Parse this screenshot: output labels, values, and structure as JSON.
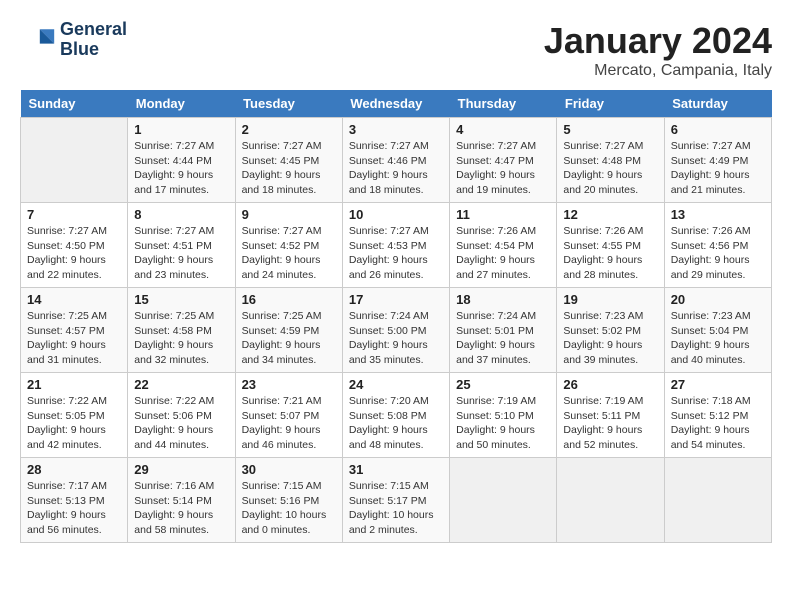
{
  "header": {
    "logo_line1": "General",
    "logo_line2": "Blue",
    "month": "January 2024",
    "location": "Mercato, Campania, Italy"
  },
  "days_of_week": [
    "Sunday",
    "Monday",
    "Tuesday",
    "Wednesday",
    "Thursday",
    "Friday",
    "Saturday"
  ],
  "weeks": [
    [
      {
        "day": "",
        "empty": true
      },
      {
        "day": "1",
        "sunrise": "7:27 AM",
        "sunset": "4:44 PM",
        "daylight": "9 hours and 17 minutes."
      },
      {
        "day": "2",
        "sunrise": "7:27 AM",
        "sunset": "4:45 PM",
        "daylight": "9 hours and 18 minutes."
      },
      {
        "day": "3",
        "sunrise": "7:27 AM",
        "sunset": "4:46 PM",
        "daylight": "9 hours and 18 minutes."
      },
      {
        "day": "4",
        "sunrise": "7:27 AM",
        "sunset": "4:47 PM",
        "daylight": "9 hours and 19 minutes."
      },
      {
        "day": "5",
        "sunrise": "7:27 AM",
        "sunset": "4:48 PM",
        "daylight": "9 hours and 20 minutes."
      },
      {
        "day": "6",
        "sunrise": "7:27 AM",
        "sunset": "4:49 PM",
        "daylight": "9 hours and 21 minutes."
      }
    ],
    [
      {
        "day": "7",
        "sunrise": "7:27 AM",
        "sunset": "4:50 PM",
        "daylight": "9 hours and 22 minutes."
      },
      {
        "day": "8",
        "sunrise": "7:27 AM",
        "sunset": "4:51 PM",
        "daylight": "9 hours and 23 minutes."
      },
      {
        "day": "9",
        "sunrise": "7:27 AM",
        "sunset": "4:52 PM",
        "daylight": "9 hours and 24 minutes."
      },
      {
        "day": "10",
        "sunrise": "7:27 AM",
        "sunset": "4:53 PM",
        "daylight": "9 hours and 26 minutes."
      },
      {
        "day": "11",
        "sunrise": "7:26 AM",
        "sunset": "4:54 PM",
        "daylight": "9 hours and 27 minutes."
      },
      {
        "day": "12",
        "sunrise": "7:26 AM",
        "sunset": "4:55 PM",
        "daylight": "9 hours and 28 minutes."
      },
      {
        "day": "13",
        "sunrise": "7:26 AM",
        "sunset": "4:56 PM",
        "daylight": "9 hours and 29 minutes."
      }
    ],
    [
      {
        "day": "14",
        "sunrise": "7:25 AM",
        "sunset": "4:57 PM",
        "daylight": "9 hours and 31 minutes."
      },
      {
        "day": "15",
        "sunrise": "7:25 AM",
        "sunset": "4:58 PM",
        "daylight": "9 hours and 32 minutes."
      },
      {
        "day": "16",
        "sunrise": "7:25 AM",
        "sunset": "4:59 PM",
        "daylight": "9 hours and 34 minutes."
      },
      {
        "day": "17",
        "sunrise": "7:24 AM",
        "sunset": "5:00 PM",
        "daylight": "9 hours and 35 minutes."
      },
      {
        "day": "18",
        "sunrise": "7:24 AM",
        "sunset": "5:01 PM",
        "daylight": "9 hours and 37 minutes."
      },
      {
        "day": "19",
        "sunrise": "7:23 AM",
        "sunset": "5:02 PM",
        "daylight": "9 hours and 39 minutes."
      },
      {
        "day": "20",
        "sunrise": "7:23 AM",
        "sunset": "5:04 PM",
        "daylight": "9 hours and 40 minutes."
      }
    ],
    [
      {
        "day": "21",
        "sunrise": "7:22 AM",
        "sunset": "5:05 PM",
        "daylight": "9 hours and 42 minutes."
      },
      {
        "day": "22",
        "sunrise": "7:22 AM",
        "sunset": "5:06 PM",
        "daylight": "9 hours and 44 minutes."
      },
      {
        "day": "23",
        "sunrise": "7:21 AM",
        "sunset": "5:07 PM",
        "daylight": "9 hours and 46 minutes."
      },
      {
        "day": "24",
        "sunrise": "7:20 AM",
        "sunset": "5:08 PM",
        "daylight": "9 hours and 48 minutes."
      },
      {
        "day": "25",
        "sunrise": "7:19 AM",
        "sunset": "5:10 PM",
        "daylight": "9 hours and 50 minutes."
      },
      {
        "day": "26",
        "sunrise": "7:19 AM",
        "sunset": "5:11 PM",
        "daylight": "9 hours and 52 minutes."
      },
      {
        "day": "27",
        "sunrise": "7:18 AM",
        "sunset": "5:12 PM",
        "daylight": "9 hours and 54 minutes."
      }
    ],
    [
      {
        "day": "28",
        "sunrise": "7:17 AM",
        "sunset": "5:13 PM",
        "daylight": "9 hours and 56 minutes."
      },
      {
        "day": "29",
        "sunrise": "7:16 AM",
        "sunset": "5:14 PM",
        "daylight": "9 hours and 58 minutes."
      },
      {
        "day": "30",
        "sunrise": "7:15 AM",
        "sunset": "5:16 PM",
        "daylight": "10 hours and 0 minutes."
      },
      {
        "day": "31",
        "sunrise": "7:15 AM",
        "sunset": "5:17 PM",
        "daylight": "10 hours and 2 minutes."
      },
      {
        "day": "",
        "empty": true
      },
      {
        "day": "",
        "empty": true
      },
      {
        "day": "",
        "empty": true
      }
    ]
  ],
  "labels": {
    "sunrise_prefix": "Sunrise: ",
    "sunset_prefix": "Sunset: ",
    "daylight_prefix": "Daylight: "
  }
}
